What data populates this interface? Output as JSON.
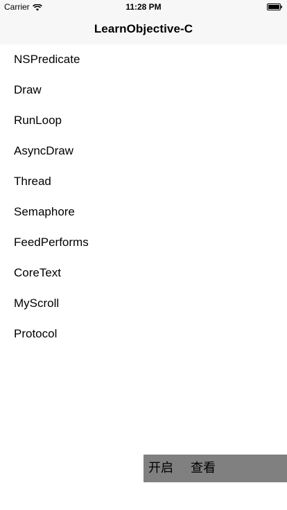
{
  "status_bar": {
    "carrier": "Carrier",
    "time": "11:28 PM",
    "icons": [
      "wifi-icon",
      "battery-icon"
    ]
  },
  "nav": {
    "title": "LearnObjective-C"
  },
  "list": {
    "items": [
      {
        "label": "NSPredicate"
      },
      {
        "label": "Draw"
      },
      {
        "label": "RunLoop"
      },
      {
        "label": "AsyncDraw"
      },
      {
        "label": "Thread"
      },
      {
        "label": "Semaphore"
      },
      {
        "label": "FeedPerforms"
      },
      {
        "label": "CoreText"
      },
      {
        "label": "MyScroll"
      },
      {
        "label": "Protocol"
      }
    ]
  },
  "floating_bar": {
    "open_label": "开启",
    "view_label": "查看",
    "background": "#808080"
  },
  "colors": {
    "bar_background": "#f7f7f7",
    "page_background": "#ffffff",
    "text": "#000000"
  }
}
